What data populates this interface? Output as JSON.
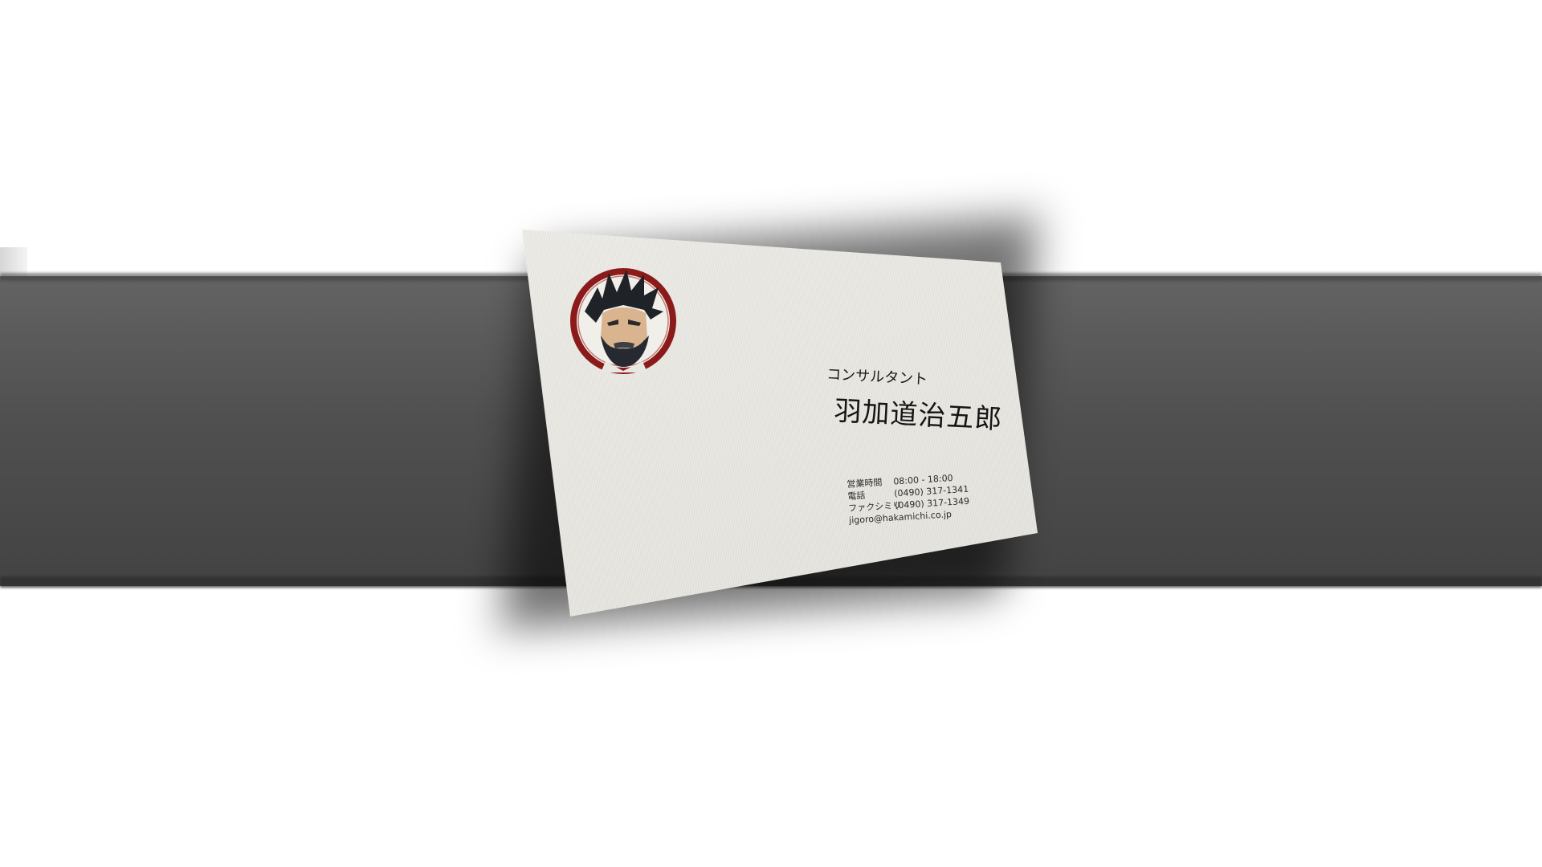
{
  "scene": {
    "band_color": "#505050",
    "background_color": "#ffffff"
  },
  "card": {
    "emblem_icon": "bearded-man-portrait-icon",
    "emblem_ring_color": "#8b1a1a",
    "title": "コンサルタント",
    "name": "羽加道治五郎",
    "hours_label": "営業時間",
    "hours_value": "08:00 - 18:00",
    "phone_label": "電話",
    "phone_value": "(0490) 317-1341",
    "fax_label": "ファクシミリ",
    "fax_value": "(0490) 317-1349",
    "email": "jigoro@hakamichi.co.jp"
  }
}
